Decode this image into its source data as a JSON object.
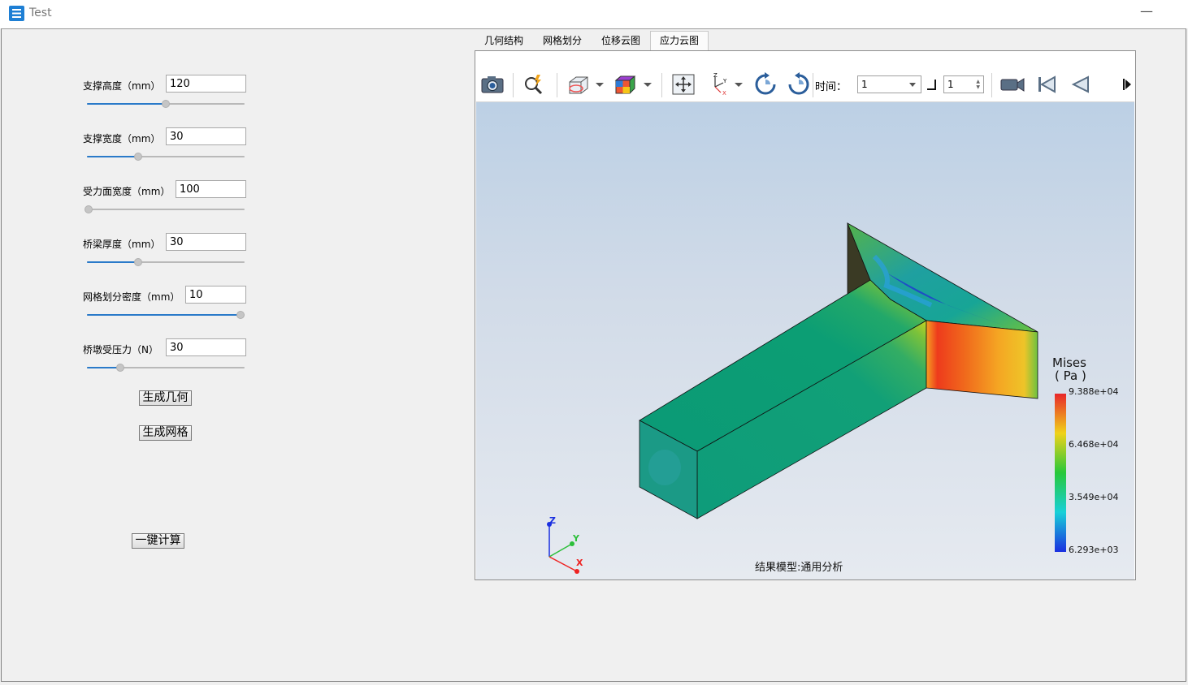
{
  "window": {
    "title": "Test",
    "minimize": "—"
  },
  "params": [
    {
      "label": "支撑高度（mm）",
      "value": "120",
      "slider": 0.5
    },
    {
      "label": "支撑宽度（mm）",
      "value": "30",
      "slider": 0.33
    },
    {
      "label": "受力面宽度（mm）",
      "value": "100",
      "slider": 0.0
    },
    {
      "label": "桥梁厚度（mm）",
      "value": "30",
      "slider": 0.33
    },
    {
      "label": "网格划分密度（mm）",
      "value": "10",
      "slider": 1.0
    },
    {
      "label": "桥墩受压力（N）",
      "value": "30",
      "slider": 0.21
    }
  ],
  "buttons": {
    "gen_geometry": "生成几何",
    "gen_mesh": "生成网格",
    "compute": "一键计算"
  },
  "tabs": [
    "几何结构",
    "网格划分",
    "位移云图",
    "应力云图"
  ],
  "active_tab": 3,
  "toolbar": {
    "time_label": "时间：",
    "time_value": "1",
    "step_value": "1"
  },
  "viewport": {
    "result_label": "结果模型:通用分析"
  },
  "legend": {
    "title_line1": "Mises",
    "title_line2": "( Pa )",
    "ticks": [
      "9.388e+04",
      "6.468e+04",
      "3.549e+04",
      "6.293e+03"
    ]
  },
  "axes": {
    "x": "X",
    "y": "Y",
    "z": "Z"
  },
  "colors": {
    "accent": "#2a7ac9",
    "legend_high": "#e8262a",
    "legend_low": "#1a2fe0"
  }
}
